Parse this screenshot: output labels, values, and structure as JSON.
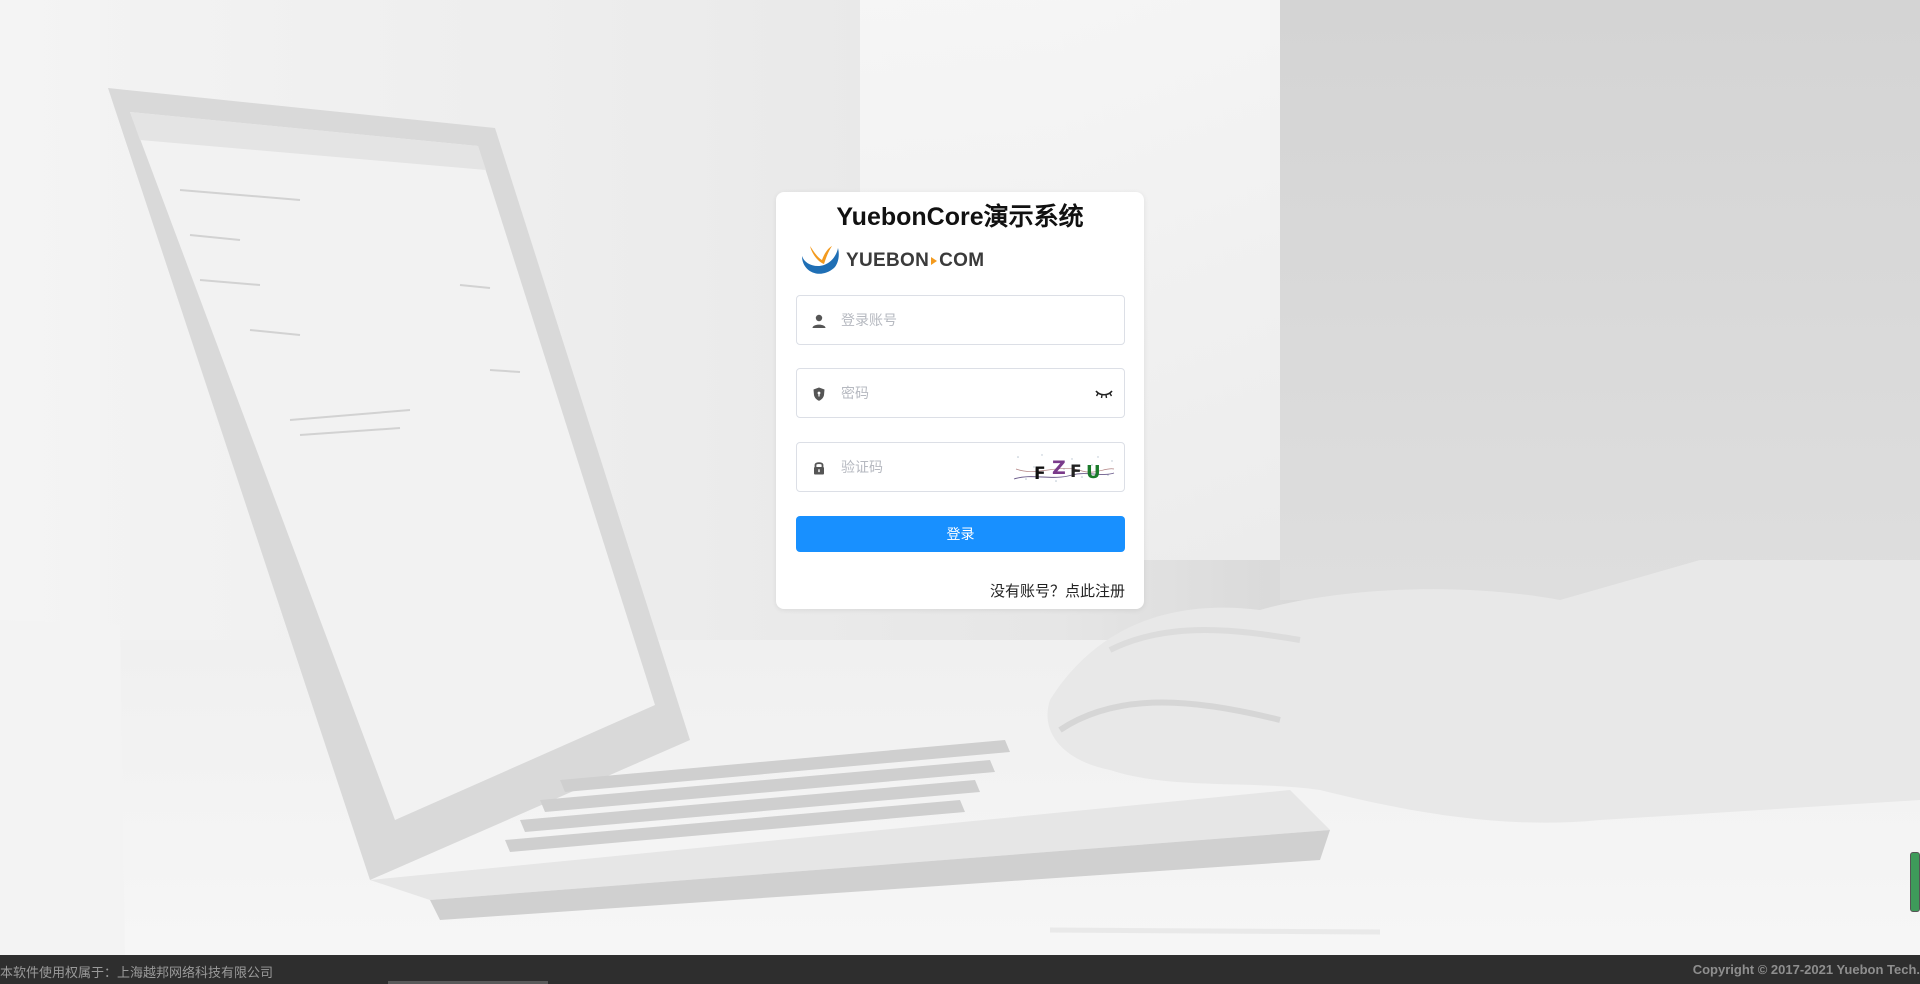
{
  "login": {
    "title": "YuebonCore演示系统",
    "logo_text_left": "YUEBON",
    "logo_text_right": "COM",
    "username_placeholder": "登录账号",
    "password_placeholder": "密码",
    "captcha_placeholder": "验证码",
    "captcha_chars": [
      "F",
      "Z",
      "F",
      "U"
    ],
    "submit_label": "登录",
    "register_link": "没有账号？点此注册"
  },
  "footer": {
    "left_text": "本软件使用权属于：上海越邦网络科技有限公司",
    "right_text": "Copyright © 2017-2021 Yuebon Tech."
  },
  "colors": {
    "primary": "#1890ff",
    "footer_bg": "#2e2e2e",
    "logo_orange": "#f39a1e",
    "logo_blue": "#1f6fb5"
  },
  "icons": {
    "username": "user-icon",
    "password": "shield-icon",
    "captcha": "lock-icon",
    "toggle_password": "eye-closed-icon"
  }
}
